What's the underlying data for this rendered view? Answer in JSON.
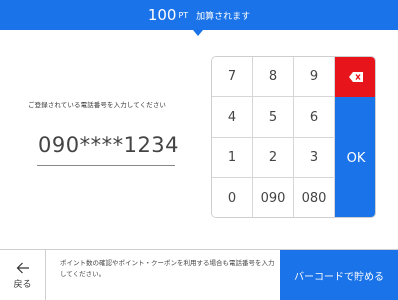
{
  "banner": {
    "points": "100",
    "unit": "PT",
    "message": "加算されます"
  },
  "prompt": "ご登録されている電話番号を入力してください",
  "phone_input": {
    "value": "090****1234"
  },
  "keypad": {
    "keys": [
      "7",
      "8",
      "9",
      "4",
      "5",
      "6",
      "1",
      "2",
      "3",
      "0",
      "090",
      "080"
    ],
    "delete_icon": "backspace-icon",
    "ok_label": "OK"
  },
  "footer": {
    "back_icon": "arrow-left-icon",
    "back_label": "戻る",
    "info_text": "ポイント数の確認やポイント・クーポンを利用する場合も電話番号を入力してください。",
    "barcode_button_label": "バーコードで貯める"
  },
  "colors": {
    "accent": "#1a73e8",
    "delete": "#e8141b"
  }
}
